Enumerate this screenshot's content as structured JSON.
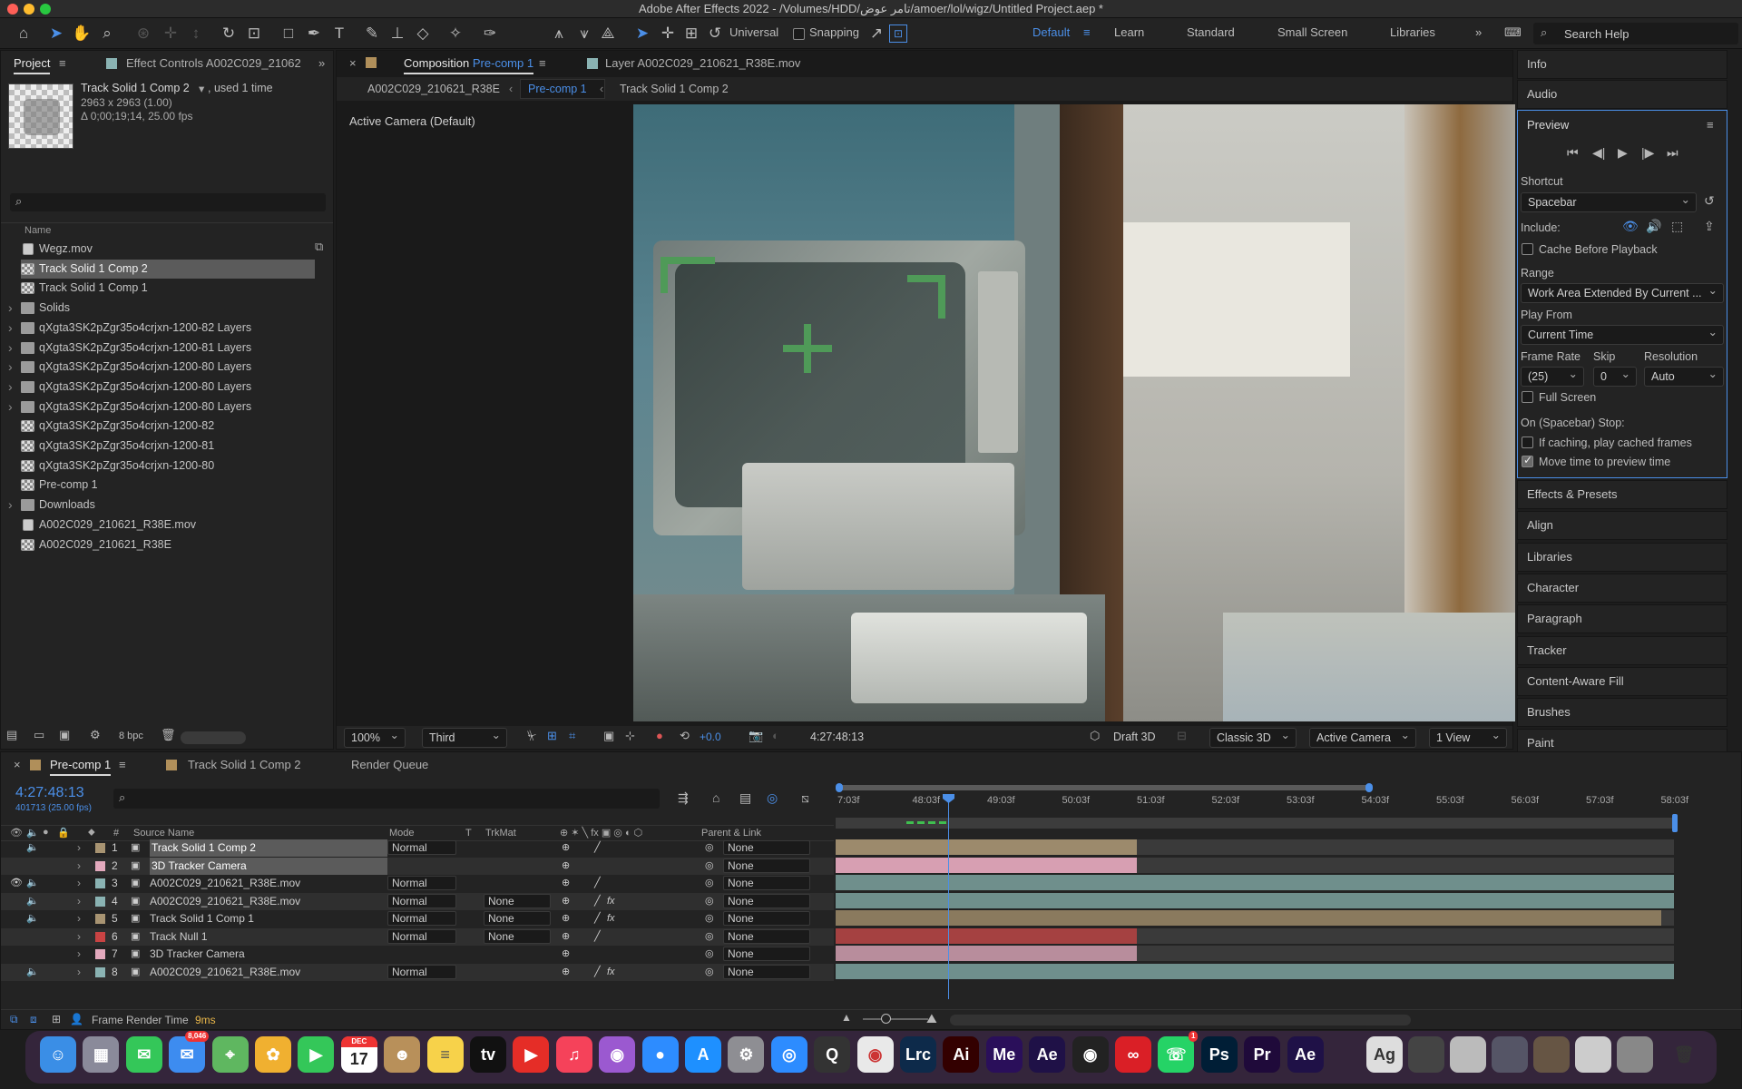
{
  "window": {
    "title": "Adobe After Effects 2022 - /Volumes/HDD/تامر عوض/amoer/lol/wigz/Untitled Project.aep *"
  },
  "toolbar": {
    "home_icon": "home-icon",
    "universal_label": "Universal",
    "snapping_label": "Snapping",
    "workspaces": [
      "Default",
      "Learn",
      "Standard",
      "Small Screen",
      "Libraries"
    ],
    "search_placeholder": "Search Help"
  },
  "project_panel": {
    "tabs": [
      "Project",
      "Effect Controls A002C029_21062"
    ],
    "selected_name": "Track Solid 1 Comp 2",
    "used": ", used 1 time",
    "dimensions": "2963 x 2963 (1.00)",
    "duration": "Δ 0;00;19;14, 25.00 fps",
    "column_name": "Name",
    "bpc": "8 bpc",
    "items": [
      {
        "name": "Wegz.mov",
        "type": "file",
        "folder": false
      },
      {
        "name": "Track Solid 1 Comp 2",
        "type": "comp",
        "folder": false,
        "selected": true
      },
      {
        "name": "Track Solid 1 Comp 1",
        "type": "comp",
        "folder": false
      },
      {
        "name": "Solids",
        "type": "folder",
        "folder": true
      },
      {
        "name": "qXgta3SK2pZgr35o4crjxn-1200-82 Layers",
        "type": "folder",
        "folder": true
      },
      {
        "name": "qXgta3SK2pZgr35o4crjxn-1200-81 Layers",
        "type": "folder",
        "folder": true
      },
      {
        "name": "qXgta3SK2pZgr35o4crjxn-1200-80 Layers",
        "type": "folder",
        "folder": true
      },
      {
        "name": "qXgta3SK2pZgr35o4crjxn-1200-80 Layers",
        "type": "folder",
        "folder": true
      },
      {
        "name": "qXgta3SK2pZgr35o4crjxn-1200-80 Layers",
        "type": "folder",
        "folder": true
      },
      {
        "name": "qXgta3SK2pZgr35o4crjxn-1200-82",
        "type": "comp",
        "folder": false
      },
      {
        "name": "qXgta3SK2pZgr35o4crjxn-1200-81",
        "type": "comp",
        "folder": false
      },
      {
        "name": "qXgta3SK2pZgr35o4crjxn-1200-80",
        "type": "comp",
        "folder": false
      },
      {
        "name": "Pre-comp 1",
        "type": "comp",
        "folder": false
      },
      {
        "name": "Downloads",
        "type": "folder",
        "folder": true
      },
      {
        "name": "A002C029_210621_R38E.mov",
        "type": "file",
        "folder": false
      },
      {
        "name": "A002C029_210621_R38E",
        "type": "comp",
        "folder": false
      }
    ]
  },
  "comp_panel": {
    "tab_prefix": "Composition",
    "tab_name": "Pre-comp 1",
    "layer_tab": "Layer A002C029_210621_R38E.mov",
    "crumbs": [
      "A002C029_210621_R38E",
      "Pre-comp 1",
      "Track Solid 1 Comp 2"
    ],
    "camera_label": "Active Camera (Default)",
    "footer": {
      "zoom": "100%",
      "resolution": "Third",
      "exposure": "+0.0",
      "timecode": "4:27:48:13",
      "draft": "Draft 3D",
      "renderer": "Classic 3D",
      "camera": "Active Camera",
      "views": "1 View"
    }
  },
  "right_panel": {
    "info": "Info",
    "audio": "Audio",
    "preview_title": "Preview",
    "shortcut_label": "Shortcut",
    "shortcut_value": "Spacebar",
    "include_label": "Include:",
    "cache_before": "Cache Before Playback",
    "range_label": "Range",
    "range_value": "Work Area Extended By Current ...",
    "play_from_label": "Play From",
    "play_from_value": "Current Time",
    "frame_rate_label": "Frame Rate",
    "skip_label": "Skip",
    "resolution_label": "Resolution",
    "frame_rate_value": "(25)",
    "skip_value": "0",
    "resolution_value": "Auto",
    "full_screen": "Full Screen",
    "stop_label": "On (Spacebar) Stop:",
    "if_caching": "If caching, play cached frames",
    "move_time": "Move time to preview time",
    "panels": [
      "Effects & Presets",
      "Align",
      "Libraries",
      "Character",
      "Paragraph",
      "Tracker",
      "Content-Aware Fill",
      "Brushes",
      "Paint"
    ]
  },
  "timeline": {
    "tabs": [
      "Pre-comp 1",
      "Track Solid 1 Comp 2",
      "Render Queue"
    ],
    "timecode": "4:27:48:13",
    "frame_info": "401713 (25.00 fps)",
    "headers": {
      "num": "#",
      "source": "Source Name",
      "mode": "Mode",
      "t": "T",
      "trkmat": "TrkMat",
      "parent": "Parent & Link"
    },
    "ruler": [
      "7:03f",
      "48:03f",
      "49:03f",
      "50:03f",
      "51:03f",
      "52:03f",
      "53:03f",
      "54:03f",
      "55:03f",
      "56:03f",
      "57:03f",
      "58:03f"
    ],
    "layers": [
      {
        "num": "1",
        "name": "Track Solid 1 Comp 2",
        "mode": "Normal",
        "trkmat": "",
        "parent": "None",
        "label": "#a89472",
        "bar": "#9c8a6c",
        "selected": true
      },
      {
        "num": "2",
        "name": "3D Tracker Camera",
        "mode": "",
        "trkmat": "",
        "parent": "None",
        "label": "#e3a9bd",
        "bar": "#d79fb2",
        "selected": true
      },
      {
        "num": "3",
        "name": "A002C029_210621_R38E.mov",
        "mode": "Normal",
        "trkmat": "",
        "parent": "None",
        "label": "#8ab3b3",
        "bar": "#6f8f8c"
      },
      {
        "num": "4",
        "name": "A002C029_210621_R38E.mov",
        "mode": "Normal",
        "trkmat": "None",
        "parent": "None",
        "label": "#8ab3b3",
        "bar": "#6f8f8c"
      },
      {
        "num": "5",
        "name": "Track Solid 1 Comp 1",
        "mode": "Normal",
        "trkmat": "None",
        "parent": "None",
        "label": "#a89472",
        "bar": "#8a7a5e"
      },
      {
        "num": "6",
        "name": "Track Null 1",
        "mode": "Normal",
        "trkmat": "None",
        "parent": "None",
        "label": "#c94343",
        "bar": "#a54141"
      },
      {
        "num": "7",
        "name": "3D Tracker Camera",
        "mode": "",
        "trkmat": "",
        "parent": "None",
        "label": "#e3a9bd",
        "bar": "#b88d9c"
      },
      {
        "num": "8",
        "name": "A002C029_210621_R38E.mov",
        "mode": "Normal",
        "trkmat": "",
        "parent": "None",
        "label": "#8ab3b3",
        "bar": "#6f8f8c"
      }
    ],
    "render_time_label": "Frame Render Time",
    "render_time_value": "9ms"
  },
  "dock": {
    "mail_badge": "8,046",
    "cal_month": "DEC",
    "cal_day": "17",
    "whatsapp_badge": "1",
    "apps": [
      "finder",
      "launchpad",
      "messages",
      "mail",
      "maps",
      "photos",
      "facetime",
      "calendar",
      "contacts",
      "notes",
      "tv",
      "youtube",
      "music",
      "podcasts",
      "zoom",
      "appstore",
      "settings",
      "safari",
      "quicktime",
      "chrome",
      "lrc",
      "ai",
      "me",
      "ae",
      "cinema4d",
      "creativecloud",
      "whatsapp",
      "ps",
      "pr",
      "ae2"
    ]
  }
}
